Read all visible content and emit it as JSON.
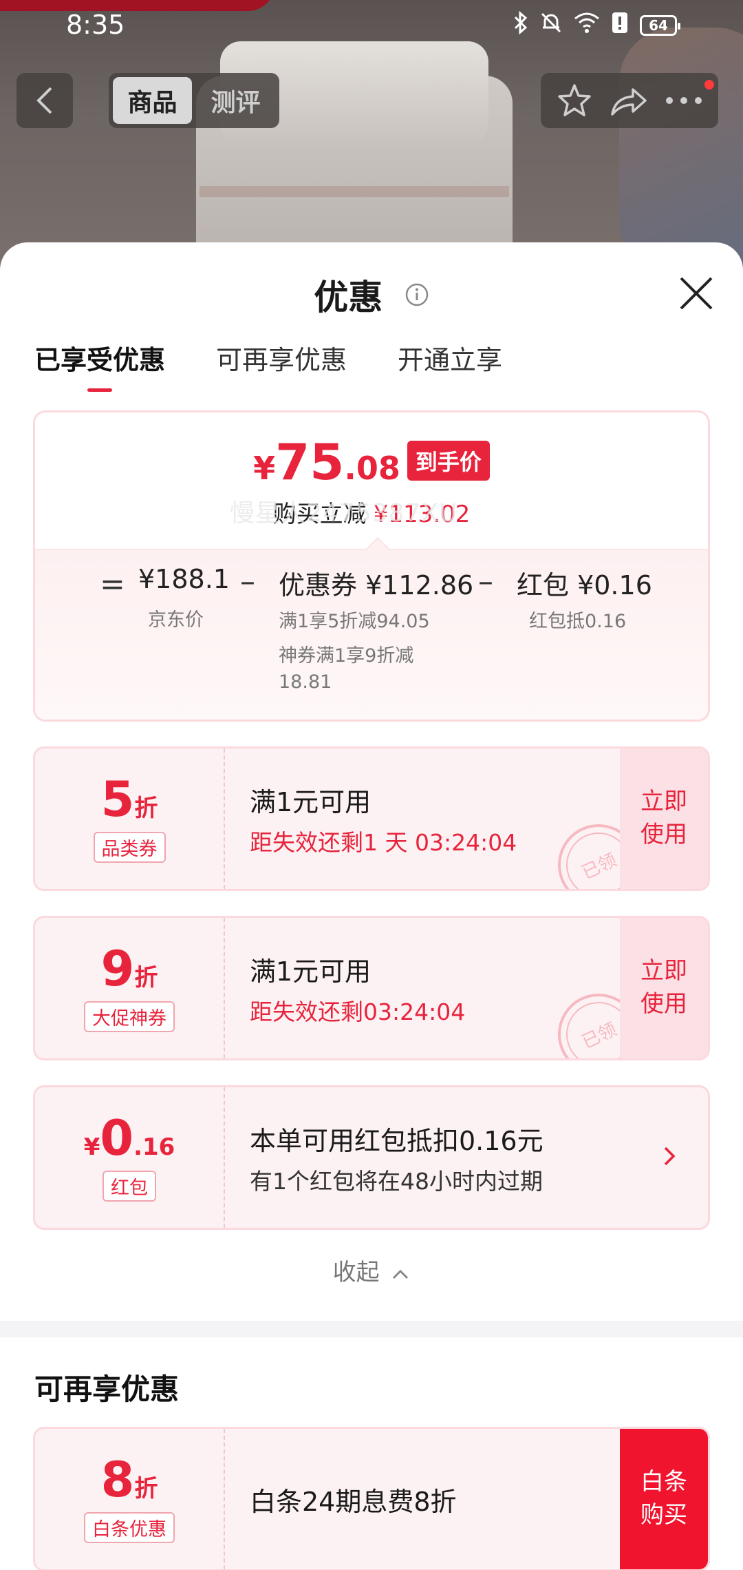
{
  "status_bar": {
    "time": "8:35",
    "battery": "64"
  },
  "top_nav": {
    "segment_items": [
      "商品",
      "测评"
    ]
  },
  "sheet": {
    "title": "优惠",
    "tabs": [
      "已享受优惠",
      "可再享优惠",
      "开通立享"
    ],
    "summary": {
      "currency": "¥",
      "price_int": "75",
      "price_dec": ".08",
      "price_tag": "到手价",
      "reduce_label": "购买立减",
      "reduce_value": "¥113.02",
      "eq": "=",
      "minus": "–",
      "jd_price": "¥188.1",
      "jd_price_label": "京东价",
      "coupon_amount": "优惠券 ¥112.86",
      "coupon_detail_1": "满1享5折减94.05",
      "coupon_detail_2": "神券满1享9折减",
      "coupon_detail_3": "18.81",
      "redpacket_amount": "红包 ¥0.16",
      "redpacket_detail": "红包抵0.16"
    },
    "watermark": "慢星人2475387XU",
    "coupons": [
      {
        "value": "5",
        "unit": "折",
        "label": "品类券",
        "line1": "满1元可用",
        "line2": "距失效还剩1 天 03:24:04",
        "action": "立即\n使用",
        "stamp": "已领"
      },
      {
        "value": "9",
        "unit": "折",
        "label": "大促神券",
        "line1": "满1元可用",
        "line2": "距失效还剩03:24:04",
        "action": "立即\n使用",
        "stamp": "已领"
      },
      {
        "currency": "¥",
        "value": "0",
        "decimal": ".16",
        "label": "红包",
        "line1": "本单可用红包抵扣0.16元",
        "line2": "有1个红包将在48小时内过期"
      }
    ],
    "collapse_label": "收起",
    "more_section_title": "可再享优惠",
    "more_coupon": {
      "value": "8",
      "unit": "折",
      "label": "白条优惠",
      "line1": "白条24期息费8折",
      "action": "白条\n购买"
    }
  }
}
